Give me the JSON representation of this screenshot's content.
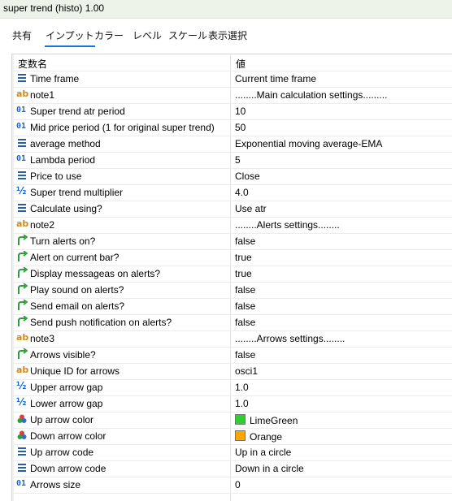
{
  "window": {
    "title": "super trend (histo) 1.00"
  },
  "tabs": [
    {
      "label": "共有"
    },
    {
      "label": "インプット"
    },
    {
      "label": "カラー"
    },
    {
      "label": "レベル"
    },
    {
      "label": "スケール"
    },
    {
      "label": "表示選択"
    }
  ],
  "grid": {
    "header": {
      "name": "変数名",
      "value": "値"
    },
    "rows": [
      {
        "icon": "list-icon",
        "name": "Time frame",
        "value": "Current time frame"
      },
      {
        "icon": "text-ab-icon",
        "name": "note1",
        "value": "........Main calculation settings........."
      },
      {
        "icon": "integer-01-icon",
        "name": "Super trend atr period",
        "value": "10"
      },
      {
        "icon": "integer-01-icon",
        "name": "Mid price period (1 for original super trend)",
        "value": "50"
      },
      {
        "icon": "list-icon",
        "name": "average method",
        "value": "Exponential moving average-EMA"
      },
      {
        "icon": "integer-01-icon",
        "name": "Lambda period",
        "value": "5"
      },
      {
        "icon": "list-icon",
        "name": "Price to use",
        "value": "Close"
      },
      {
        "icon": "double-half-icon",
        "name": "Super trend multiplier",
        "value": "4.0"
      },
      {
        "icon": "list-icon",
        "name": "Calculate using?",
        "value": "Use atr"
      },
      {
        "icon": "text-ab-icon",
        "name": "note2",
        "value": "........Alerts  settings........"
      },
      {
        "icon": "bool-arrow-icon",
        "name": "Turn alerts on?",
        "value": "false"
      },
      {
        "icon": "bool-arrow-icon",
        "name": "Alert on current bar?",
        "value": "true"
      },
      {
        "icon": "bool-arrow-icon",
        "name": "Display messageas on alerts?",
        "value": "true"
      },
      {
        "icon": "bool-arrow-icon",
        "name": "Play sound on alerts?",
        "value": "false"
      },
      {
        "icon": "bool-arrow-icon",
        "name": "Send email on alerts?",
        "value": "false"
      },
      {
        "icon": "bool-arrow-icon",
        "name": "Send push notification on alerts?",
        "value": "false"
      },
      {
        "icon": "text-ab-icon",
        "name": "note3",
        "value": "........Arrows  settings........"
      },
      {
        "icon": "bool-arrow-icon",
        "name": "Arrows visible?",
        "value": "false"
      },
      {
        "icon": "text-ab-icon",
        "name": "Unique ID for arrows",
        "value": "osci1"
      },
      {
        "icon": "double-half-icon",
        "name": "Upper arrow gap",
        "value": "1.0"
      },
      {
        "icon": "double-half-icon",
        "name": "Lower arrow gap",
        "value": "1.0"
      },
      {
        "icon": "color-icon",
        "name": "Up arrow color",
        "value": "LimeGreen",
        "swatch": "#32cd32"
      },
      {
        "icon": "color-icon",
        "name": "Down arrow color",
        "value": "Orange",
        "swatch": "#ffa500"
      },
      {
        "icon": "list-icon",
        "name": "Up arrow code",
        "value": "Up in a circle"
      },
      {
        "icon": "list-icon",
        "name": "Down arrow code",
        "value": "Down in a circle"
      },
      {
        "icon": "integer-01-icon",
        "name": "Arrows size",
        "value": "0"
      }
    ]
  },
  "colors": {
    "titlebar": "#eef3ea",
    "accent": "#1a73d9",
    "bool_icon": "#2e9e3e",
    "list_icon": "#2b5ea8"
  }
}
